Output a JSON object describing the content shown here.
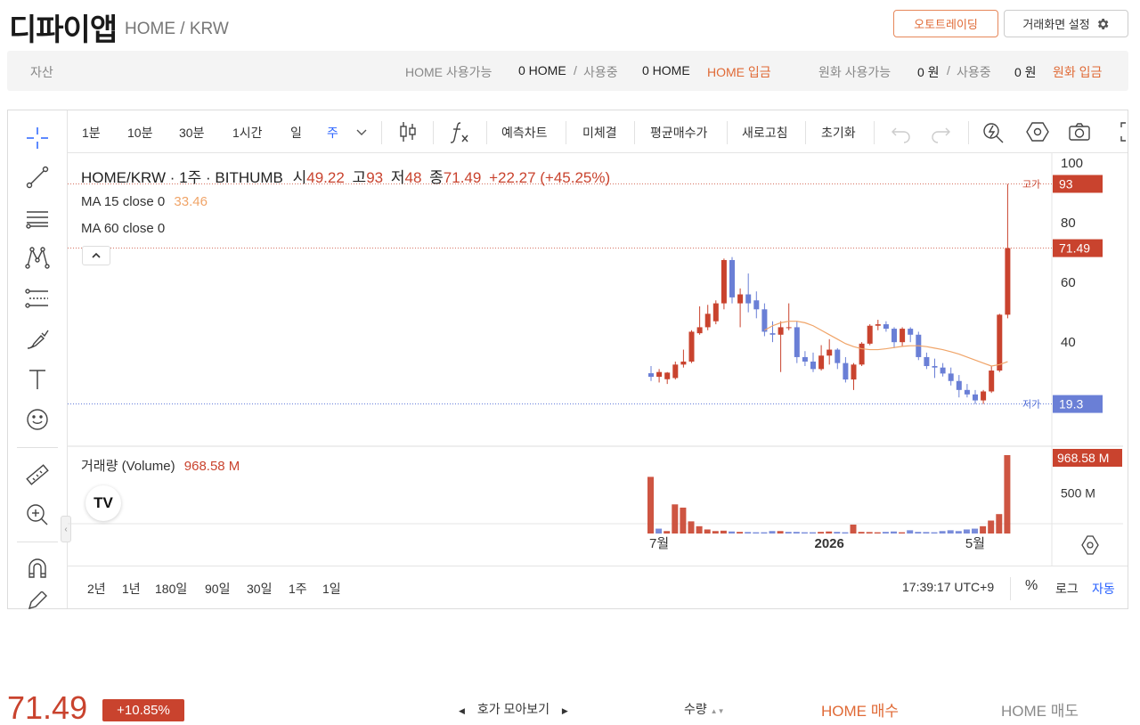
{
  "header": {
    "title": "디파이앱",
    "breadcrumb": "HOME / KRW",
    "autotrade_label": "오토트레이딩",
    "settings_label": "거래화면 설정"
  },
  "assets": {
    "label": "자산",
    "home_available_label": "HOME 사용가능",
    "home_available_value": "0 HOME",
    "slash_1": "/",
    "in_use_label_1": "사용중",
    "home_in_use_value": "0 HOME",
    "home_deposit": "HOME 입금",
    "krw_available_label": "원화 사용가능",
    "krw_available_value": "0 원",
    "slash_2": "/",
    "in_use_label_2": "사용중",
    "krw_in_use_value": "0 원",
    "krw_deposit": "원화 입금"
  },
  "toolbar": {
    "intervals": [
      "1분",
      "10분",
      "30분",
      "1시간",
      "일",
      "주"
    ],
    "active_interval": "주",
    "actions": [
      "예측차트",
      "미체결",
      "평균매수가",
      "새로고침",
      "초기화"
    ]
  },
  "chart_legend": {
    "symbol": "HOME/KRW · 1주 · BITHUMB",
    "open_label": "시",
    "open": "49.22",
    "high_label": "고",
    "high": "93",
    "low_label": "저",
    "low": "48",
    "close_label": "종",
    "close": "71.49",
    "change": "+22.27 (+45.25%)",
    "ma15_label": "MA 15 close 0",
    "ma15_value": "33.46",
    "ma60_label": "MA 60 close 0",
    "volume_label": "거래량 (Volume)",
    "volume_value": "968.58 M"
  },
  "price_axis": {
    "ticks": [
      "100",
      "80",
      "60",
      "40"
    ],
    "high_tag_label": "고가",
    "high_tag": "93",
    "last_tag": "71.49",
    "low_tag_label": "저가",
    "low_tag": "19.3",
    "volume_tag": "968.58 M",
    "volume_tick": "500 M"
  },
  "time_axis": {
    "labels": [
      "7월",
      "2026",
      "5월"
    ]
  },
  "range_bar": {
    "ranges": [
      "2년",
      "1년",
      "180일",
      "90일",
      "30일",
      "1주",
      "1일"
    ],
    "clock": "17:39:17 UTC+9",
    "percent": "%",
    "log": "로그",
    "auto": "자동"
  },
  "footer": {
    "price": "71.49",
    "change_badge": "+10.85%",
    "orderbook_label": "호가 모아보기",
    "quantity_label": "수량",
    "buy_tab": "HOME 매수",
    "sell_tab": "HOME 매도"
  },
  "colors": {
    "up": "#c9432e",
    "down": "#6a7fd6",
    "accent": "#e06a36",
    "ma15": "#f0a468",
    "active_blue": "#2962ff"
  },
  "chart_data": {
    "type": "candlestick",
    "interval": "1주",
    "y_range": [
      15,
      100
    ],
    "candles": [
      {
        "o": 29.6,
        "h": 32.0,
        "l": 27.0,
        "c": 28.4
      },
      {
        "o": 28.4,
        "h": 31.0,
        "l": 26.5,
        "c": 30.0
      },
      {
        "o": 27.6,
        "h": 30.0,
        "l": 26.0,
        "c": 29.8
      },
      {
        "o": 28.0,
        "h": 33.5,
        "l": 27.5,
        "c": 32.5
      },
      {
        "o": 32.5,
        "h": 37.5,
        "l": 31.5,
        "c": 33.5
      },
      {
        "o": 33.5,
        "h": 44.0,
        "l": 33.0,
        "c": 43.5
      },
      {
        "o": 43.0,
        "h": 52.0,
        "l": 42.5,
        "c": 45.0
      },
      {
        "o": 45.0,
        "h": 52.5,
        "l": 44.0,
        "c": 49.5
      },
      {
        "o": 47.0,
        "h": 54.0,
        "l": 46.0,
        "c": 53.0
      },
      {
        "o": 53.0,
        "h": 68.0,
        "l": 51.0,
        "c": 67.5
      },
      {
        "o": 67.5,
        "h": 68.5,
        "l": 53.0,
        "c": 55.0
      },
      {
        "o": 53.0,
        "h": 58.0,
        "l": 45.0,
        "c": 56.0
      },
      {
        "o": 56.0,
        "h": 63.0,
        "l": 50.0,
        "c": 53.0
      },
      {
        "o": 54.0,
        "h": 57.0,
        "l": 48.0,
        "c": 51.0
      },
      {
        "o": 51.0,
        "h": 53.0,
        "l": 42.0,
        "c": 43.5
      },
      {
        "o": 43.0,
        "h": 47.0,
        "l": 40.0,
        "c": 42.5
      },
      {
        "o": 42.5,
        "h": 47.0,
        "l": 30.0,
        "c": 45.0
      },
      {
        "o": 45.0,
        "h": 53.0,
        "l": 44.0,
        "c": 45.0
      },
      {
        "o": 45.0,
        "h": 47.0,
        "l": 33.0,
        "c": 35.0
      },
      {
        "o": 35.0,
        "h": 37.0,
        "l": 32.0,
        "c": 33.5
      },
      {
        "o": 33.5,
        "h": 36.5,
        "l": 30.0,
        "c": 31.0
      },
      {
        "o": 31.0,
        "h": 39.0,
        "l": 30.5,
        "c": 35.5
      },
      {
        "o": 35.5,
        "h": 41.0,
        "l": 32.5,
        "c": 37.5
      },
      {
        "o": 37.5,
        "h": 38.0,
        "l": 31.0,
        "c": 33.0
      },
      {
        "o": 33.0,
        "h": 35.0,
        "l": 26.5,
        "c": 27.5
      },
      {
        "o": 27.5,
        "h": 33.0,
        "l": 24.0,
        "c": 32.5
      },
      {
        "o": 32.5,
        "h": 40.0,
        "l": 32.0,
        "c": 39.5
      },
      {
        "o": 39.5,
        "h": 46.0,
        "l": 39.0,
        "c": 45.5
      },
      {
        "o": 45.5,
        "h": 47.5,
        "l": 44.0,
        "c": 46.0
      },
      {
        "o": 46.0,
        "h": 47.0,
        "l": 43.5,
        "c": 44.5
      },
      {
        "o": 44.5,
        "h": 45.0,
        "l": 38.0,
        "c": 40.0
      },
      {
        "o": 40.0,
        "h": 45.0,
        "l": 38.5,
        "c": 44.5
      },
      {
        "o": 44.5,
        "h": 45.0,
        "l": 40.0,
        "c": 42.5
      },
      {
        "o": 42.5,
        "h": 43.5,
        "l": 34.0,
        "c": 35.0
      },
      {
        "o": 35.0,
        "h": 36.5,
        "l": 31.0,
        "c": 32.0
      },
      {
        "o": 32.0,
        "h": 34.5,
        "l": 28.0,
        "c": 31.5
      },
      {
        "o": 31.5,
        "h": 33.0,
        "l": 28.5,
        "c": 29.5
      },
      {
        "o": 29.5,
        "h": 31.5,
        "l": 25.5,
        "c": 27.0
      },
      {
        "o": 27.0,
        "h": 29.0,
        "l": 21.5,
        "c": 24.0
      },
      {
        "o": 24.0,
        "h": 26.0,
        "l": 21.5,
        "c": 22.5
      },
      {
        "o": 22.5,
        "h": 24.0,
        "l": 19.3,
        "c": 20.5
      },
      {
        "o": 20.5,
        "h": 24.0,
        "l": 19.3,
        "c": 23.5
      },
      {
        "o": 23.5,
        "h": 32.0,
        "l": 23.0,
        "c": 30.5
      },
      {
        "o": 30.5,
        "h": 49.5,
        "l": 30.0,
        "c": 49.2
      },
      {
        "o": 49.2,
        "h": 93.0,
        "l": 48.0,
        "c": 71.49
      }
    ],
    "ma15": [
      null,
      null,
      null,
      null,
      null,
      null,
      null,
      null,
      null,
      null,
      null,
      null,
      null,
      null,
      44.0,
      45.5,
      46.5,
      47.0,
      47.0,
      46.5,
      45.5,
      44.0,
      42.5,
      41.0,
      39.5,
      38.5,
      37.8,
      37.5,
      37.5,
      37.8,
      38.2,
      38.6,
      38.8,
      38.8,
      38.5,
      38.0,
      37.5,
      36.8,
      36.0,
      35.0,
      34.0,
      33.0,
      32.0,
      32.5,
      33.46
    ],
    "volume_millions": [
      700,
      60,
      30,
      360,
      320,
      150,
      90,
      50,
      30,
      35,
      25,
      20,
      18,
      15,
      15,
      30,
      30,
      20,
      20,
      15,
      15,
      20,
      25,
      20,
      15,
      110,
      20,
      18,
      15,
      20,
      25,
      15,
      40,
      20,
      18,
      15,
      30,
      40,
      30,
      50,
      60,
      90,
      160,
      240,
      968.58
    ],
    "volume_up": [
      true,
      false,
      true,
      true,
      true,
      true,
      true,
      true,
      true,
      true,
      false,
      true,
      false,
      false,
      false,
      false,
      true,
      false,
      false,
      false,
      false,
      true,
      true,
      false,
      false,
      true,
      true,
      true,
      true,
      false,
      false,
      true,
      false,
      false,
      false,
      false,
      false,
      false,
      false,
      false,
      false,
      true,
      true,
      true,
      true
    ]
  }
}
